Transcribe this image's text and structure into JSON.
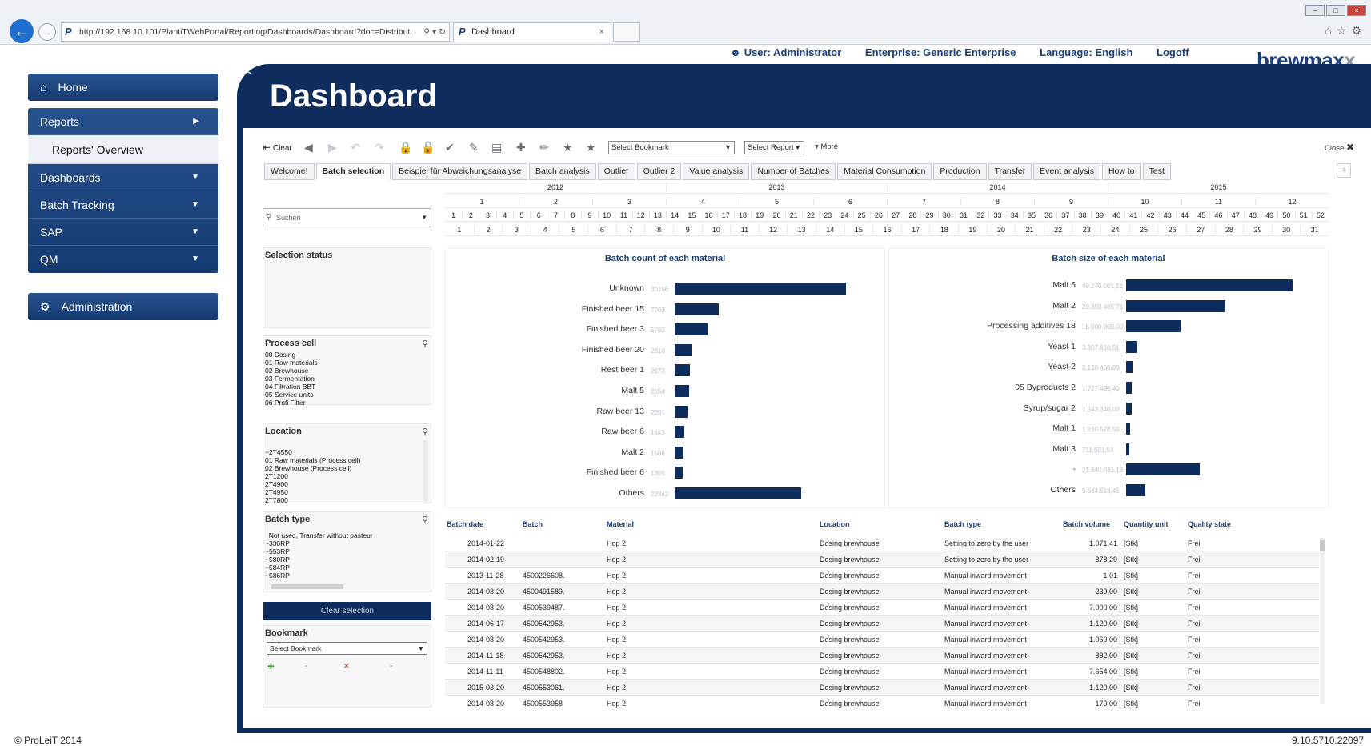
{
  "browser": {
    "url": "http://192.168.10.101/PlantiTWebPortal/Reporting/Dashboards/Dashboard?doc=Distributi",
    "tab_title": "Dashboard"
  },
  "header": {
    "user": "User: Administrator",
    "enterprise": "Enterprise: Generic Enterprise",
    "language": "Language: English",
    "logoff": "Logoff",
    "brand_main": "brewmax",
    "brand_x": "x"
  },
  "nav": {
    "home": "Home",
    "reports": "Reports",
    "reports_overview": "Reports' Overview",
    "dashboards": "Dashboards",
    "batch_tracking": "Batch Tracking",
    "sap": "SAP",
    "qm": "QM",
    "administration": "Administration"
  },
  "page": {
    "collapse": "<<",
    "title": "Dashboard"
  },
  "toolbar": {
    "clear": "Clear",
    "select_bookmark": "Select Bookmark",
    "select_report": "Select Report",
    "more": "More",
    "close": "Close"
  },
  "tabs": [
    "Welcome!",
    "Batch selection",
    "Beispiel für Abweichungsanalyse",
    "Batch analysis",
    "Outlier",
    "Outlier 2",
    "Value analysis",
    "Number  of Batches",
    "Material Consumption",
    "Production",
    "Transfer",
    "Event analysis",
    "How to",
    "Test"
  ],
  "active_tab": "Batch selection",
  "timeline": {
    "years": [
      "2012",
      "2013",
      "2014",
      "2015"
    ],
    "months": [
      "1",
      "2",
      "3",
      "4",
      "5",
      "6",
      "7",
      "8",
      "9",
      "10",
      "11",
      "12"
    ],
    "weeks": [
      "1",
      "2",
      "3",
      "4",
      "5",
      "6",
      "7",
      "8",
      "9",
      "10",
      "11",
      "12",
      "13",
      "14",
      "15",
      "16",
      "17",
      "18",
      "19",
      "20",
      "21",
      "22",
      "23",
      "24",
      "25",
      "26",
      "27",
      "28",
      "29",
      "30",
      "31",
      "32",
      "33",
      "34",
      "35",
      "36",
      "37",
      "38",
      "39",
      "40",
      "41",
      "42",
      "43",
      "44",
      "45",
      "46",
      "47",
      "48",
      "49",
      "50",
      "51",
      "52"
    ],
    "days": [
      "1",
      "2",
      "3",
      "4",
      "5",
      "6",
      "7",
      "8",
      "9",
      "10",
      "11",
      "12",
      "13",
      "14",
      "15",
      "16",
      "17",
      "18",
      "19",
      "20",
      "21",
      "22",
      "23",
      "24",
      "25",
      "26",
      "27",
      "28",
      "29",
      "30",
      "31"
    ]
  },
  "filters": {
    "search_placeholder": "Suchen",
    "selection_status": "Selection status",
    "process_cell": {
      "title": "Process cell",
      "items": [
        "00 Dosing",
        "01 Raw materials",
        "02 Brewhouse",
        "03 Fermentation",
        "04 Filtration BBT",
        "05 Service units",
        "06 Profi Filter"
      ]
    },
    "location": {
      "title": "Location",
      "items": [
        "~2T4550",
        "01 Raw materials (Process cell)",
        "02 Brewhouse (Process cell)",
        "2T1200",
        "2T4900",
        "2T4950",
        "2T7800"
      ]
    },
    "batch_type": {
      "title": "Batch type",
      "items": [
        "_Not used, Transfer without pasteur",
        "~330RP",
        "~553RP",
        "~580RP",
        "~584RP",
        "~586RP"
      ]
    },
    "clear_selection": "Clear selection",
    "bookmark": {
      "title": "Bookmark",
      "select": "Select Bookmark",
      "add": "+",
      "dash1": "-",
      "remove": "×",
      "dash2": "-"
    }
  },
  "chart_data": [
    {
      "type": "bar",
      "orientation": "horizontal",
      "title": "Batch count of each material",
      "categories": [
        "Unknown",
        "Finished beer 15",
        "Finished beer 3",
        "Finished beer 20",
        "Rest beer 1",
        "Malt 5",
        "Raw beer 13",
        "Raw beer 6",
        "Malt 2",
        "Finished beer 6",
        "Others"
      ],
      "values": [
        30196,
        7703,
        5762,
        2910,
        2673,
        2554,
        2201,
        1643,
        1506,
        1365,
        22342
      ],
      "value_labels": [
        "30196",
        "7703",
        "5762",
        "2910",
        "2673",
        "2554",
        "2201",
        "1643",
        "1506",
        "1365",
        "22342"
      ]
    },
    {
      "type": "bar",
      "orientation": "horizontal",
      "title": "Batch size of each material",
      "categories": [
        "Malt 5",
        "Malt 2",
        "Processing additives 18",
        "Yeast 1",
        "Yeast 2",
        "05 Byproducts 2",
        "Syrup/sugar 2",
        "Malt 1",
        "Malt 3",
        "-",
        "Others"
      ],
      "values": [
        49270001.51,
        29398465.71,
        16000000.0,
        3307810.51,
        2130458.0,
        1727496.4,
        1543340.0,
        1230528.5,
        711501.54,
        21840031.18,
        5684518.45
      ],
      "value_labels": [
        "49.270.001,51",
        "29.398.465,71",
        "16.000.000,00",
        "3.307.810,51",
        "2.130.458,00",
        "1.727.496,40",
        "1.543.340,00",
        "1.230.528,50",
        "711.501,54",
        "21.840.031,18",
        "5.684.518,45"
      ]
    }
  ],
  "table": {
    "headers": [
      "Batch date",
      "Batch",
      "Material",
      "Location",
      "Batch type",
      "Batch volume",
      "Quantity unit",
      "Quality state"
    ],
    "rows": [
      [
        "2014-01-22",
        "",
        "Hop 2",
        "Dosing brewhouse",
        "Setting to zero by the user",
        "1.071,41",
        "[Stk]",
        "Frei"
      ],
      [
        "2014-02-19",
        "",
        "Hop 2",
        "Dosing brewhouse",
        "Setting to zero by the user",
        "878,29",
        "[Stk]",
        "Frei"
      ],
      [
        "2013-11-28",
        "4500226608.",
        "Hop 2",
        "Dosing brewhouse",
        "Manual inward movement",
        "1,01",
        "[Stk]",
        "Frei"
      ],
      [
        "2014-08-20",
        "4500491589.",
        "Hop 2",
        "Dosing brewhouse",
        "Manual inward movement",
        "239,00",
        "[Stk]",
        "Frei"
      ],
      [
        "2014-08-20",
        "4500539487.",
        "Hop 2",
        "Dosing brewhouse",
        "Manual inward movement",
        "7.000,00",
        "[Stk]",
        "Frei"
      ],
      [
        "2014-06-17",
        "4500542953.",
        "Hop 2",
        "Dosing brewhouse",
        "Manual inward movement",
        "1.120,00",
        "[Stk]",
        "Frei"
      ],
      [
        "2014-08-20",
        "4500542953.",
        "Hop 2",
        "Dosing brewhouse",
        "Manual inward movement",
        "1.060,00",
        "[Stk]",
        "Frei"
      ],
      [
        "2014-11-18",
        "4500542953.",
        "Hop 2",
        "Dosing brewhouse",
        "Manual inward movement",
        "882,00",
        "[Stk]",
        "Frei"
      ],
      [
        "2014-11-11",
        "4500548802.",
        "Hop 2",
        "Dosing brewhouse",
        "Manual inward movement",
        "7.654,00",
        "[Stk]",
        "Frei"
      ],
      [
        "2015-03-20",
        "4500553061.",
        "Hop 2",
        "Dosing brewhouse",
        "Manual inward movement",
        "1.120,00",
        "[Stk]",
        "Frei"
      ],
      [
        "2014-08-20",
        "4500553958",
        "Hop 2",
        "Dosing brewhouse",
        "Manual inward movement",
        "170,00",
        "[Stk]",
        "Frei"
      ]
    ]
  },
  "footer": {
    "copyright": "© ProLeiT 2014",
    "version": "9.10.5710.22097"
  },
  "colors": {
    "navy": "#0e2c5c",
    "nav_blue": "#28528d",
    "accent_text": "#1a3e7a"
  }
}
